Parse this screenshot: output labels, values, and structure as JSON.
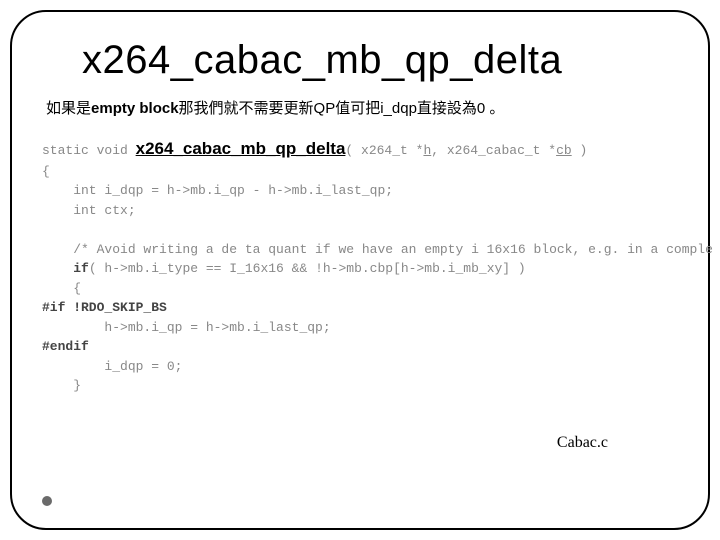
{
  "title": "x264_cabac_mb_qp_delta",
  "desc": {
    "prefix": "如果是",
    "bold": "empty block",
    "suffix": "那我們就不需要更新QP值可把i_dqp直接設為0 。"
  },
  "code": {
    "l1a": "static void ",
    "l1fn": "x264_cabac_mb_qp_delta",
    "l1b": "( x264_t *",
    "l1c": "h",
    "l1d": ", x264_cabac_t *",
    "l1e": "cb",
    "l1f": " )",
    "l2": "{",
    "l3": "    int i_dqp = h->mb.i_qp - h->mb.i_last_qp;",
    "l4": "    int ctx;",
    "l5": "",
    "l6": "    /* Avoid writing a de ta quant if we have an empty i 16x16 block, e.g. in a comple",
    "l7a": "    ",
    "l7b": "if",
    "l7c": "( h->mb.i_type == I_16x16 && !h->mb.cbp[h->mb.i_mb_xy] )",
    "l8": "    {",
    "l9": "#if !RDO_SKIP_BS",
    "l10": "        h->mb.i_qp = h->mb.i_last_qp;",
    "l11": "#endif",
    "l12": "        i_dqp = 0;",
    "l13": "    }"
  },
  "citation": "Cabac.c"
}
